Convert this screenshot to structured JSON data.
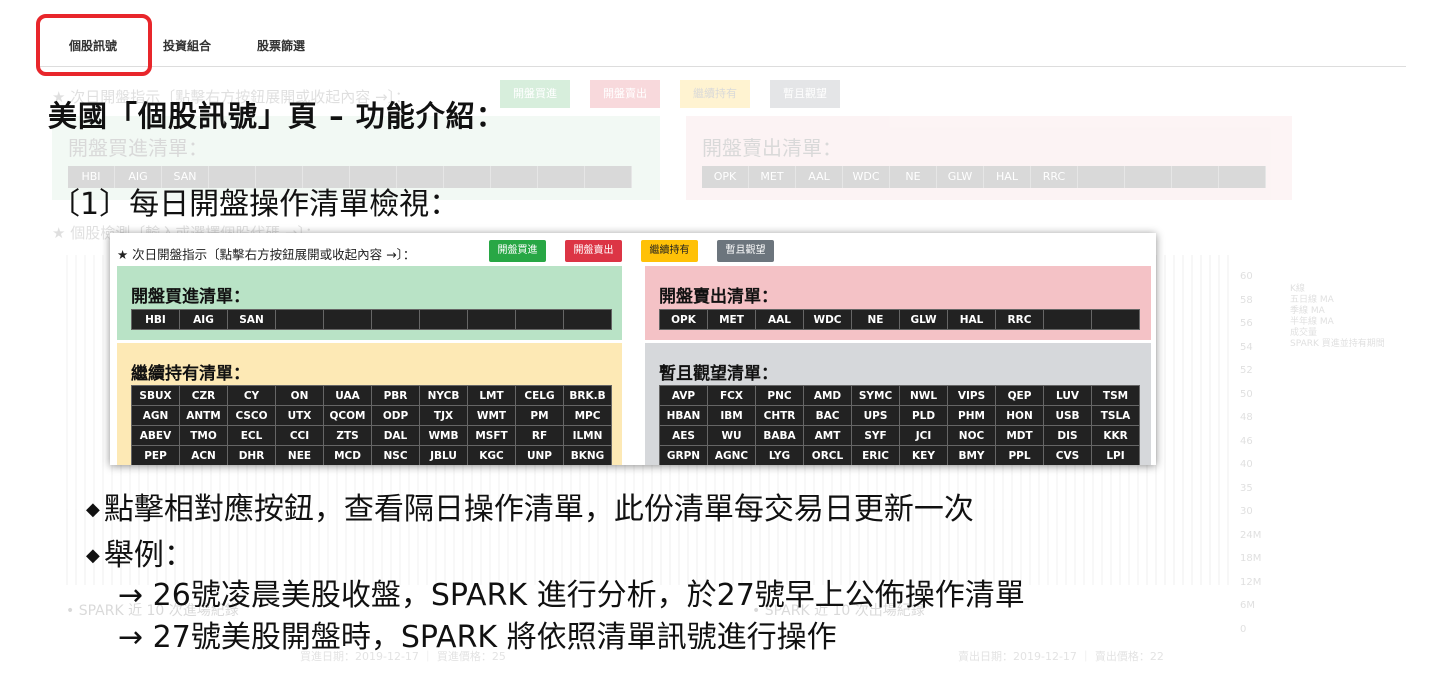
{
  "tabs": [
    {
      "label": "個股訊號",
      "active": true
    },
    {
      "label": "投資組合",
      "active": false
    },
    {
      "label": "股票篩選",
      "active": false
    }
  ],
  "heading": "美國「個股訊號」頁 – 功能介紹：",
  "section_title": "〔1〕每日開盤操作清單檢視：",
  "inset": {
    "instruction": "★ 次日開盤指示〔點擊右方按鈕展開或收起內容 →〕：",
    "buttons": [
      {
        "label": "開盤買進",
        "color": "#28a745",
        "text_color": "#ffffff"
      },
      {
        "label": "開盤賣出",
        "color": "#dc3545",
        "text_color": "#ffffff"
      },
      {
        "label": "繼續持有",
        "color": "#ffc107",
        "text_color": "#222222"
      },
      {
        "label": "暫且觀望",
        "color": "#6c757d",
        "text_color": "#ffffff"
      }
    ],
    "buy": {
      "title": "開盤買進清單：",
      "color": "#b9e3c6",
      "rows": [
        [
          "HBI",
          "AIG",
          "SAN",
          "",
          "",
          "",
          "",
          "",
          "",
          ""
        ]
      ]
    },
    "sell": {
      "title": "開盤賣出清單：",
      "color": "#f4c2c6",
      "rows": [
        [
          "OPK",
          "MET",
          "AAL",
          "WDC",
          "NE",
          "GLW",
          "HAL",
          "RRC",
          "",
          ""
        ]
      ]
    },
    "hold": {
      "title": "繼續持有清單：",
      "color": "#fde9b5",
      "rows": [
        [
          "SBUX",
          "CZR",
          "CY",
          "ON",
          "UAA",
          "PBR",
          "NYCB",
          "LMT",
          "CELG",
          "BRK.B"
        ],
        [
          "AGN",
          "ANTM",
          "CSCO",
          "UTX",
          "QCOM",
          "ODP",
          "TJX",
          "WMT",
          "PM",
          "MPC"
        ],
        [
          "ABEV",
          "TMO",
          "ECL",
          "CCI",
          "ZTS",
          "DAL",
          "WMB",
          "MSFT",
          "RF",
          "ILMN"
        ],
        [
          "PEP",
          "ACN",
          "DHR",
          "NEE",
          "MCD",
          "NSC",
          "JBLU",
          "KGC",
          "UNP",
          "BKNG"
        ]
      ]
    },
    "watch": {
      "title": "暫且觀望清單：",
      "color": "#d6d8db",
      "rows": [
        [
          "AVP",
          "FCX",
          "PNC",
          "AMD",
          "SYMC",
          "NWL",
          "VIPS",
          "QEP",
          "LUV",
          "TSM"
        ],
        [
          "HBAN",
          "IBM",
          "CHTR",
          "BAC",
          "UPS",
          "PLD",
          "PHM",
          "HON",
          "USB",
          "TSLA"
        ],
        [
          "AES",
          "WU",
          "BABA",
          "AMT",
          "SYF",
          "JCI",
          "NOC",
          "MDT",
          "DIS",
          "KKR"
        ],
        [
          "GRPN",
          "AGNC",
          "LYG",
          "ORCL",
          "ERIC",
          "KEY",
          "BMY",
          "PPL",
          "CVS",
          "LPI"
        ]
      ]
    }
  },
  "bullets": [
    "點擊相對應按鈕，查看隔日操作清單，此份清單每交易日更新一次",
    "舉例："
  ],
  "examples": [
    "→ 26號凌晨美股收盤，SPARK 進行分析，於27號早上公佈操作清單",
    "→ 27號美股開盤時，SPARK 將依照清單訊號進行操作"
  ],
  "background": {
    "instruction": "★ 次日開盤指示〔點擊右方按鈕展開或收起內容 →〕：",
    "buy_title": "開盤買進清單：",
    "buy_row": [
      "HBI",
      "AIG",
      "SAN"
    ],
    "sell_title": "開盤賣出清單：",
    "sell_row": [
      "OPK",
      "MET",
      "AAL",
      "WDC",
      "NE",
      "GLW",
      "HAL",
      "RRC"
    ],
    "lookup": "★ 個股檢測〔輸入或選擇個股代碼 →〕：",
    "y_ticks": [
      "60",
      "58",
      "56",
      "54",
      "52",
      "50",
      "48",
      "46",
      "40",
      "35",
      "30",
      "24M",
      "18M",
      "12M",
      "6M",
      "0"
    ],
    "legend": [
      "K線",
      "五日線 MA",
      "季線 MA",
      "半年線 MA",
      "成交量",
      "SPARK 買進並持有期間"
    ],
    "left_footer": "• SPARK 近 10 次進場紀錄",
    "right_footer": "• SPARK 近 10 次出場紀錄",
    "stat_left": "買進日期：2019-12-17 ｜ 買進價格：25",
    "stat_right": "賣出日期：2019-12-17 ｜ 賣出價格：22"
  }
}
